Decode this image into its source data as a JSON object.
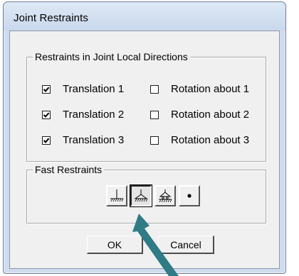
{
  "window": {
    "title": "Joint Restraints"
  },
  "restraints_group": {
    "legend": "Restraints in Joint Local Directions",
    "translations": [
      {
        "label": "Translation  1",
        "checked": true
      },
      {
        "label": "Translation  2",
        "checked": true
      },
      {
        "label": "Translation  3",
        "checked": true
      }
    ],
    "rotations": [
      {
        "label": "Rotation about  1",
        "checked": false
      },
      {
        "label": "Rotation about  2",
        "checked": false
      },
      {
        "label": "Rotation about  3",
        "checked": false
      }
    ]
  },
  "fast_group": {
    "legend": "Fast Restraints",
    "buttons": [
      {
        "icon": "fixed-support-icon",
        "pressed": false
      },
      {
        "icon": "pinned-support-icon",
        "pressed": true
      },
      {
        "icon": "roller-support-icon",
        "pressed": false
      },
      {
        "icon": "free-joint-icon",
        "pressed": false
      }
    ]
  },
  "footer": {
    "ok_label": "OK",
    "cancel_label": "Cancel"
  },
  "colors": {
    "window_frame": "#cfdcee",
    "client": "#f0f0f0",
    "annotation_arrow": "#2f7b86"
  }
}
